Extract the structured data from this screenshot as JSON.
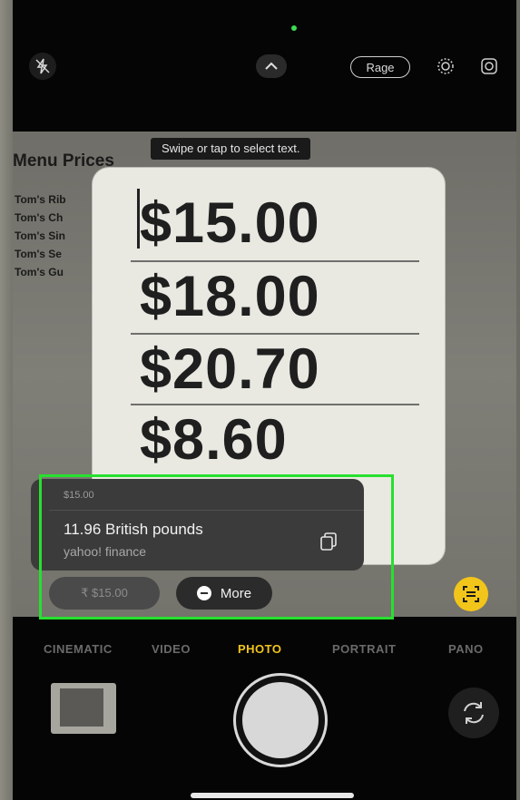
{
  "top_bar": {
    "flash_icon": "flash-off-icon",
    "chevron_icon": "chevron-up-icon",
    "pill_label": "Rage",
    "icon2": "live-photo-icon",
    "icon3": "settings-icon"
  },
  "viewfinder": {
    "hint": "Swipe or tap to select text.",
    "menu_title": "Menu Prices",
    "menu_items": [
      "Tom's Rib",
      "Tom's Ch",
      "Tom's Sin",
      "Tom's Se",
      "Tom's Gu"
    ],
    "card_prices": [
      "$15.00",
      "$18.00",
      "$20.70",
      "$8.60"
    ]
  },
  "popup": {
    "selected": "$15.00",
    "conversion": "11.96 British pounds",
    "source": "yahoo! finance",
    "copy_icon": "copy-icon"
  },
  "chips": {
    "price_chip": "₹ $15.00",
    "more_label": "More"
  },
  "modes": [
    "CINEMATIC",
    "VIDEO",
    "PHOTO",
    "PORTRAIT",
    "PANO"
  ],
  "active_mode": "PHOTO",
  "colors": {
    "highlight": "#27e02e",
    "accent": "#f2c51a"
  }
}
